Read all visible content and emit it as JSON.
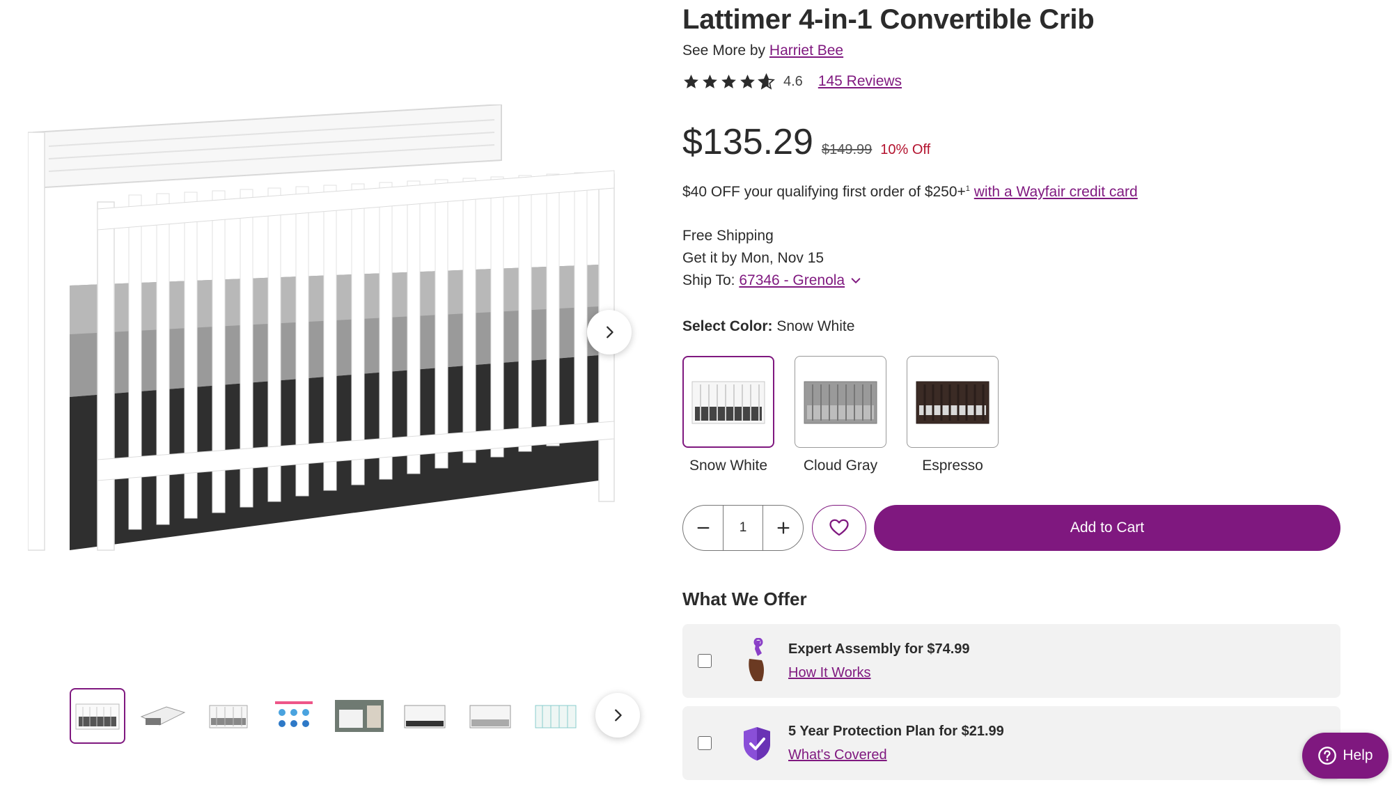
{
  "product": {
    "title": "Lattimer 4-in-1 Convertible Crib",
    "see_more_prefix": "See More by",
    "brand": "Harriet Bee",
    "rating": "4.6",
    "stars": 4.6,
    "reviews_link": "145 Reviews",
    "price": "$135.29",
    "original_price": "$149.99",
    "discount": "10% Off"
  },
  "promo": {
    "text": "$40 OFF your qualifying first order of $250+",
    "footnote": "1",
    "link": "with a Wayfair credit card"
  },
  "shipping": {
    "free": "Free Shipping",
    "delivery": "Get it by Mon, Nov 15",
    "ship_to_label": "Ship To:",
    "ship_to_value": "67346 - Grenola"
  },
  "color": {
    "label": "Select Color:",
    "selected": "Snow White",
    "options": [
      {
        "name": "Snow White",
        "hex": "#f2f2f2"
      },
      {
        "name": "Cloud Gray",
        "hex": "#8a8a8a"
      },
      {
        "name": "Espresso",
        "hex": "#3a2a24"
      }
    ]
  },
  "cart": {
    "quantity": "1",
    "add_to_cart": "Add to Cart"
  },
  "offers": {
    "title": "What We Offer",
    "items": [
      {
        "head": "Expert Assembly for $74.99",
        "link": "How It Works",
        "icon": "wrench-hand-icon"
      },
      {
        "head": "5 Year Protection Plan for $21.99",
        "link": "What's Covered",
        "icon": "shield-check-icon"
      }
    ]
  },
  "gallery": {
    "thumbnail_count": 8,
    "active_index": 0
  },
  "help": {
    "label": "Help"
  },
  "colors": {
    "brand_purple": "#7f187f",
    "sale_red": "#b3122e",
    "text": "#2b2b2b"
  }
}
